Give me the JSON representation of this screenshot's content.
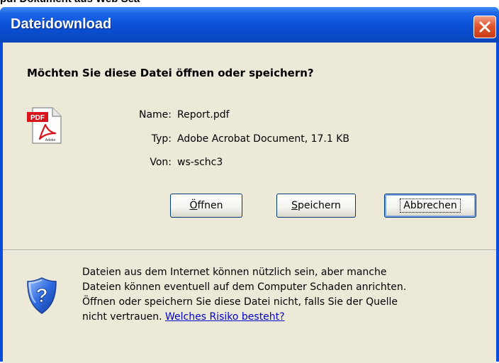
{
  "background_window": {
    "title_fragment": "pdf Dokument aus Web Sea"
  },
  "dialog": {
    "title": "Dateidownload",
    "close_icon": "close-icon",
    "question": "Möchten Sie diese Datei öffnen oder speichern?",
    "file_icon": "pdf-file-icon",
    "file_info": [
      {
        "label": "Name:",
        "value": "Report.pdf"
      },
      {
        "label": "Typ:",
        "value": "Adobe Acrobat Document, 17.1 KB"
      },
      {
        "label": "Von:",
        "value": "ws-schc3"
      }
    ],
    "buttons": {
      "open": {
        "mnemonic": "Ö",
        "rest": "ffnen"
      },
      "save": {
        "mnemonic": "S",
        "rest": "peichern"
      },
      "cancel": {
        "label": "Abbrechen"
      }
    },
    "warning": {
      "icon": "shield-question-icon",
      "lines": [
        "Dateien aus dem Internet können nützlich sein, aber manche",
        "Dateien können eventuell auf dem Computer Schaden anrichten.",
        "Öffnen oder speichern Sie diese Datei nicht, falls Sie der Quelle",
        "nicht vertrauen."
      ],
      "link_text": "Welches Risiko besteht?"
    }
  },
  "colors": {
    "titlebar": "#0a4ddb",
    "client_bg": "#ece9d8",
    "close_button": "#e0562f",
    "link": "#0000cc"
  }
}
